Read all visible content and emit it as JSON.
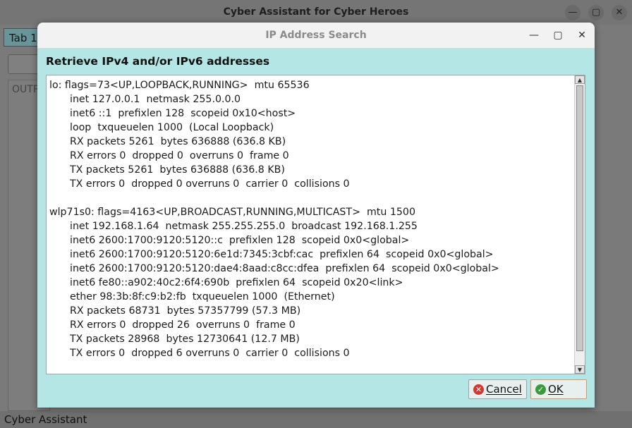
{
  "main_window": {
    "title": "Cyber Assistant for Cyber Heroes",
    "controls": {
      "minimize": "—",
      "maximize": "▢",
      "close": "✕"
    },
    "tab_label": "Tab 1:",
    "output_label": "OUTP",
    "status_text": "Cyber Assistant"
  },
  "dialog": {
    "title": "IP Address Search",
    "controls": {
      "minimize": "—",
      "maximize": "▢",
      "close": "✕"
    },
    "heading": "Retrieve IPv4 and/or IPv6 addresses",
    "output_lines": [
      {
        "text": "lo: flags=73<UP,LOOPBACK,RUNNING>  mtu 65536",
        "indent": false
      },
      {
        "text": "inet 127.0.0.1  netmask 255.0.0.0",
        "indent": true
      },
      {
        "text": "inet6 ::1  prefixlen 128  scopeid 0x10<host>",
        "indent": true
      },
      {
        "text": "loop  txqueuelen 1000  (Local Loopback)",
        "indent": true
      },
      {
        "text": "RX packets 5261  bytes 636888 (636.8 KB)",
        "indent": true
      },
      {
        "text": "RX errors 0  dropped 0  overruns 0  frame 0",
        "indent": true
      },
      {
        "text": "TX packets 5261  bytes 636888 (636.8 KB)",
        "indent": true
      },
      {
        "text": "TX errors 0  dropped 0 overruns 0  carrier 0  collisions 0",
        "indent": true
      },
      {
        "text": "",
        "indent": false
      },
      {
        "text": "wlp71s0: flags=4163<UP,BROADCAST,RUNNING,MULTICAST>  mtu 1500",
        "indent": false
      },
      {
        "text": "inet 192.168.1.64  netmask 255.255.255.0  broadcast 192.168.1.255",
        "indent": true
      },
      {
        "text": "inet6 2600:1700:9120:5120::c  prefixlen 128  scopeid 0x0<global>",
        "indent": true
      },
      {
        "text": "inet6 2600:1700:9120:5120:6e1d:7345:3cbf:cac  prefixlen 64  scopeid 0x0<global>",
        "indent": true
      },
      {
        "text": "inet6 2600:1700:9120:5120:dae4:8aad:c8cc:dfea  prefixlen 64  scopeid 0x0<global>",
        "indent": true
      },
      {
        "text": "inet6 fe80::a902:40c2:6f4:690b  prefixlen 64  scopeid 0x20<link>",
        "indent": true
      },
      {
        "text": "ether 98:3b:8f:c9:b2:fb  txqueuelen 1000  (Ethernet)",
        "indent": true
      },
      {
        "text": "RX packets 68731  bytes 57357799 (57.3 MB)",
        "indent": true
      },
      {
        "text": "RX errors 0  dropped 26  overruns 0  frame 0",
        "indent": true
      },
      {
        "text": "TX packets 28968  bytes 12730641 (12.7 MB)",
        "indent": true
      },
      {
        "text": "TX errors 0  dropped 6 overruns 0  carrier 0  collisions 0",
        "indent": true
      }
    ],
    "buttons": {
      "cancel": {
        "label": "Cancel",
        "icon": "cancel-circle-icon",
        "icon_glyph": "✕",
        "icon_color": "#d9352f"
      },
      "ok": {
        "label": "OK",
        "icon": "check-circle-icon",
        "icon_glyph": "✓",
        "icon_color": "#3c9a3c"
      }
    }
  }
}
